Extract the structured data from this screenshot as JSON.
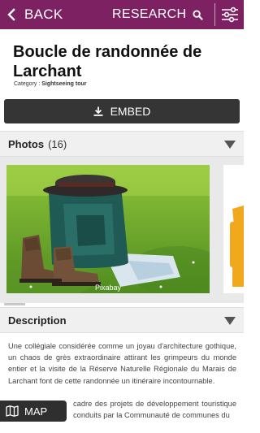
{
  "header": {
    "back_label": "BACK",
    "research_label": "RESEARCH",
    "background_color": "#7d2163",
    "icons": [
      "chevron-left-icon",
      "search-icon",
      "filter-sliders-icon"
    ]
  },
  "page": {
    "title": "Boucle de randonnée de Larchant",
    "category_prefix": "Category :",
    "category_value": "Sightseeing tour"
  },
  "embed": {
    "label": "EMBED",
    "icon": "download-icon"
  },
  "photos": {
    "title": "Photos",
    "count": "(16)",
    "items": [
      {
        "credit": "Pixabay",
        "subject": "hiking backpack, hat and boots on grass"
      },
      {
        "credit": "",
        "subject": "yellow signpost (partially visible)"
      }
    ]
  },
  "description": {
    "title": "Description",
    "paragraphs": [
      "Une collégiale considérée comme un joyau d'architecture gothique, un chaos de grès extraordinaire attirant les grimpeurs du monde entier et la visite de la Réserve Naturelle Régionale du Marais de Larchant font de cette randonnée un itinéraire incontournable.",
      "cadre des projets de développement touristique conduits par la Communauté de communes du"
    ]
  },
  "map_button": {
    "label": "MAP",
    "icon": "map-icon"
  }
}
